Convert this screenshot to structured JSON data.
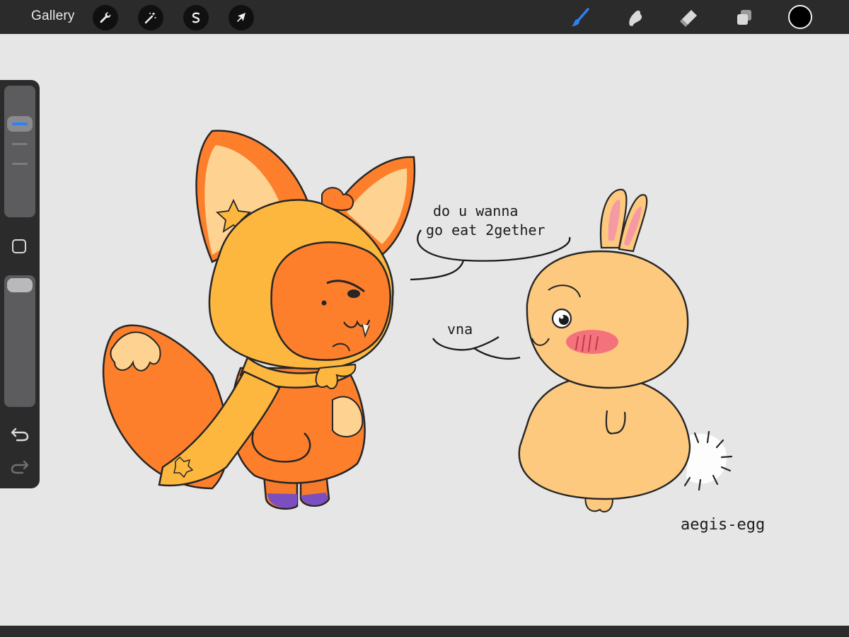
{
  "topbar": {
    "gallery_label": "Gallery",
    "left_tools": [
      {
        "icon": "wrench-icon",
        "name": "actions-button"
      },
      {
        "icon": "magic-wand-icon",
        "name": "adjustments-button"
      },
      {
        "icon": "selection-s-icon",
        "name": "selection-button"
      },
      {
        "icon": "arrow-cursor-icon",
        "name": "transform-button"
      }
    ],
    "right_tools": [
      {
        "icon": "brush-icon",
        "name": "brush-button",
        "active": true
      },
      {
        "icon": "smudge-icon",
        "name": "smudge-button"
      },
      {
        "icon": "eraser-icon",
        "name": "eraser-button"
      },
      {
        "icon": "layers-icon",
        "name": "layers-button"
      }
    ],
    "current_color": "#000000"
  },
  "colors": {
    "accent": "#2f7ff5",
    "bar": "#2b2b2c",
    "canvas": "#e6e6e6"
  },
  "sidebar": {
    "brush_size_level": 0.75,
    "opacity_level": 1.0,
    "icons": [
      "modify-icon",
      "undo-icon",
      "redo-icon"
    ]
  },
  "artwork": {
    "speech_bubble_line1": "do u wanna",
    "speech_bubble_line2": "go eat 2gether",
    "reply_text": "vna",
    "signature": "aegis-egg"
  }
}
